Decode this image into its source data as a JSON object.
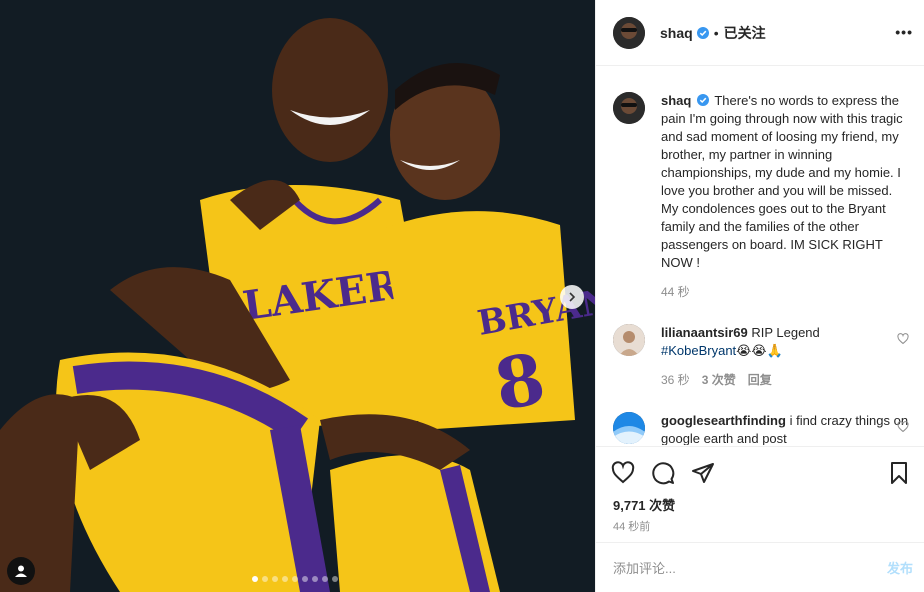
{
  "post": {
    "username": "shaq",
    "follow_state": "已关注",
    "more_label": "•••"
  },
  "caption": {
    "username": "shaq",
    "text": "There's no words to express the pain I'm going through now with this tragic and sad moment of loosing my friend, my brother, my partner in winning championships, my dude and my homie. I love you brother and you will be missed. My condolences goes out to the Bryant family and the families of the other passengers on board. IM SICK RIGHT NOW !",
    "time": "44 秒"
  },
  "comments": [
    {
      "username": "lilianaantsir69",
      "text": "RIP Legend",
      "hashtag": "#KobeBryant",
      "emoji": "😭😭🙏",
      "time": "36 秒",
      "likes": "3 次赞",
      "reply": "回复"
    },
    {
      "username": "googlesearthfinding",
      "text": "i find crazy things on google earth and post"
    }
  ],
  "jersey": {
    "team": "LAKERS",
    "name": "BRYANT",
    "number": "8"
  },
  "carousel": {
    "count": 9,
    "active": 1
  },
  "stats": {
    "likes": "9,771 次赞",
    "posted": "44 秒前"
  },
  "add_comment": {
    "placeholder": "添加评论...",
    "post_label": "发布"
  },
  "colors": {
    "lakers_gold": "#f5c518",
    "lakers_purple": "#4b2a8c",
    "verified_blue": "#3897f0",
    "hashtag_blue": "#00376b",
    "muted": "#8e8e8e"
  }
}
